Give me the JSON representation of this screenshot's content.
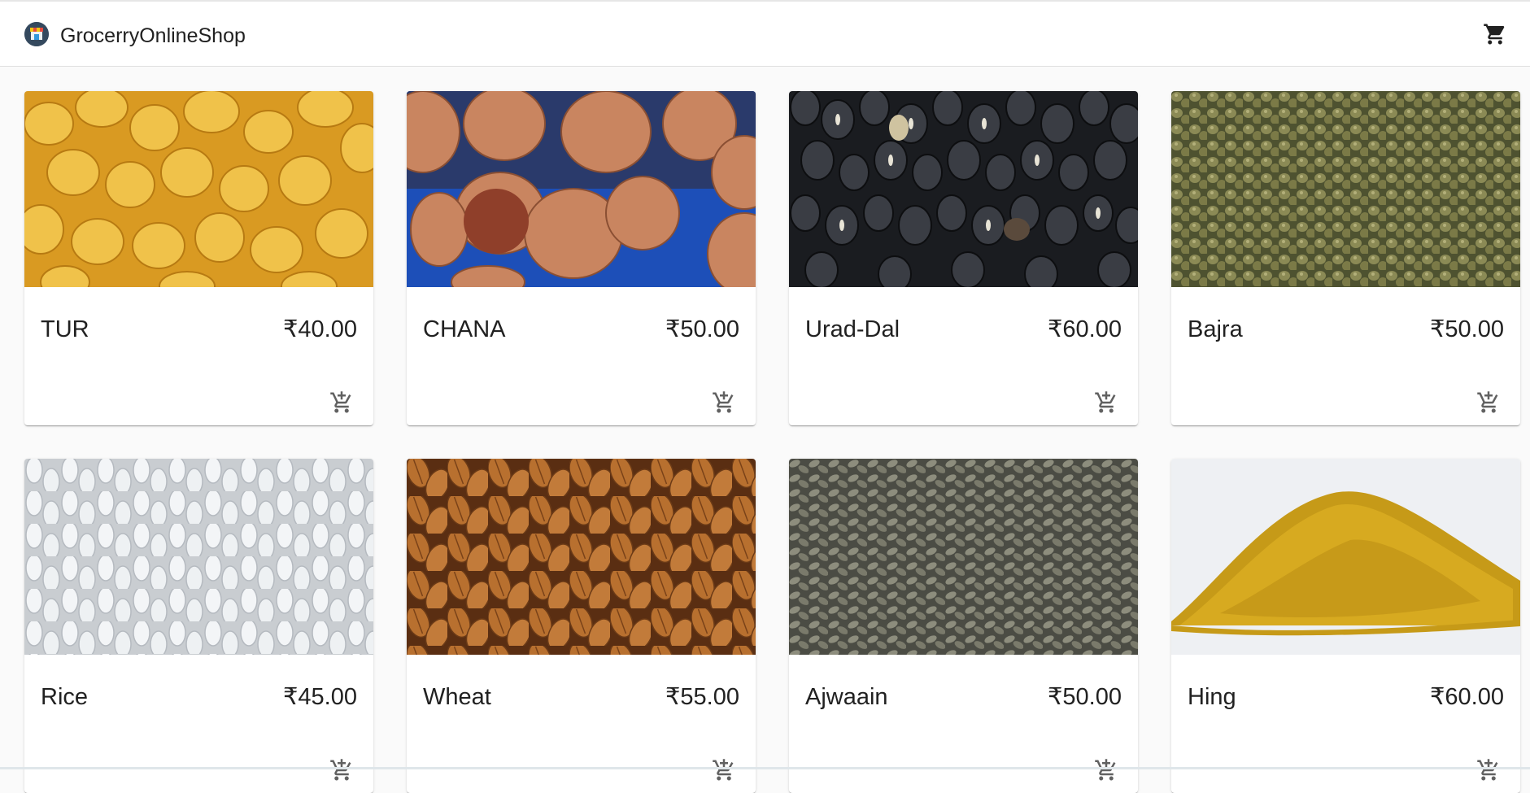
{
  "appbar": {
    "title": "GrocerryOnlineShop",
    "logo_icon": "store-icon",
    "cart_icon": "shopping-cart-icon"
  },
  "products": [
    {
      "name": "TUR",
      "price": "₹40.00",
      "image": "yellow split pigeon peas (toor dal)",
      "add_icon": "add-shopping-cart-icon"
    },
    {
      "name": "CHANA",
      "price": "₹50.00",
      "image": "brown chickpeas on blue background",
      "add_icon": "add-shopping-cart-icon"
    },
    {
      "name": "Urad-Dal",
      "price": "₹60.00",
      "image": "black gram lentils",
      "add_icon": "add-shopping-cart-icon"
    },
    {
      "name": "Bajra",
      "price": "₹50.00",
      "image": "pearl millet grains",
      "add_icon": "add-shopping-cart-icon"
    },
    {
      "name": "Rice",
      "price": "₹45.00",
      "image": "white rice grains",
      "add_icon": "add-shopping-cart-icon"
    },
    {
      "name": "Wheat",
      "price": "₹55.00",
      "image": "wheat grains",
      "add_icon": "add-shopping-cart-icon"
    },
    {
      "name": "Ajwaain",
      "price": "₹50.00",
      "image": "carom seeds",
      "add_icon": "add-shopping-cart-icon"
    },
    {
      "name": "Hing",
      "price": "₹60.00",
      "image": "yellow asafoetida powder heap",
      "add_icon": "add-shopping-cart-icon"
    }
  ],
  "colors": {
    "appbar_bg": "#ffffff",
    "page_bg": "#fafafa",
    "text": "#212121",
    "icon": "#616161"
  }
}
